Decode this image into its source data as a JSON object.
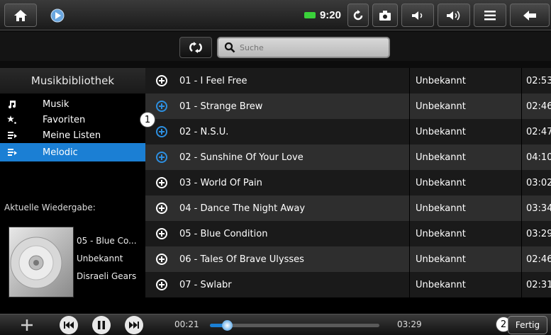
{
  "statusbar": {
    "clock": "9:20"
  },
  "search": {
    "placeholder": "Suche"
  },
  "library": {
    "title": "Musikbibliothek",
    "items": [
      {
        "label": "Musik",
        "icon": "music-note-icon"
      },
      {
        "label": "Favoriten",
        "icon": "star-icon"
      },
      {
        "label": "Meine Listen",
        "icon": "playlist-icon"
      },
      {
        "label": "Melodic",
        "icon": "playlist-icon",
        "active": true
      }
    ]
  },
  "now_playing": {
    "label": "Aktuelle Wiedergabe:",
    "title": "05 - Blue Co...",
    "artist": "Unbekannt",
    "album": "Disraeli Gears"
  },
  "tracks": [
    {
      "title": "01 - I Feel Free",
      "artist": "Unbekannt",
      "duration": "02:53",
      "added": false
    },
    {
      "title": "01 - Strange Brew",
      "artist": "Unbekannt",
      "duration": "02:46",
      "added": true
    },
    {
      "title": "02 - N.S.U.",
      "artist": "Unbekannt",
      "duration": "02:47",
      "added": true
    },
    {
      "title": "02 - Sunshine Of Your Love",
      "artist": "Unbekannt",
      "duration": "04:10",
      "added": true
    },
    {
      "title": "03 - World Of Pain",
      "artist": "Unbekannt",
      "duration": "03:02",
      "added": false
    },
    {
      "title": "04 - Dance The Night Away",
      "artist": "Unbekannt",
      "duration": "03:34",
      "added": false
    },
    {
      "title": "05 - Blue Condition",
      "artist": "Unbekannt",
      "duration": "03:29",
      "added": false
    },
    {
      "title": "06 - Tales Of Brave Ulysses",
      "artist": "Unbekannt",
      "duration": "02:46",
      "added": false
    },
    {
      "title": "07 - Swlabr",
      "artist": "Unbekannt",
      "duration": "02:31",
      "added": false
    }
  ],
  "callouts": {
    "one": "1",
    "two": "2"
  },
  "player": {
    "elapsed": "00:21",
    "total": "03:29",
    "progress_fraction": 0.1,
    "done_label": "Fertig"
  },
  "colors": {
    "accent": "#1b7fd4",
    "added_icon": "#2d8fe0"
  }
}
